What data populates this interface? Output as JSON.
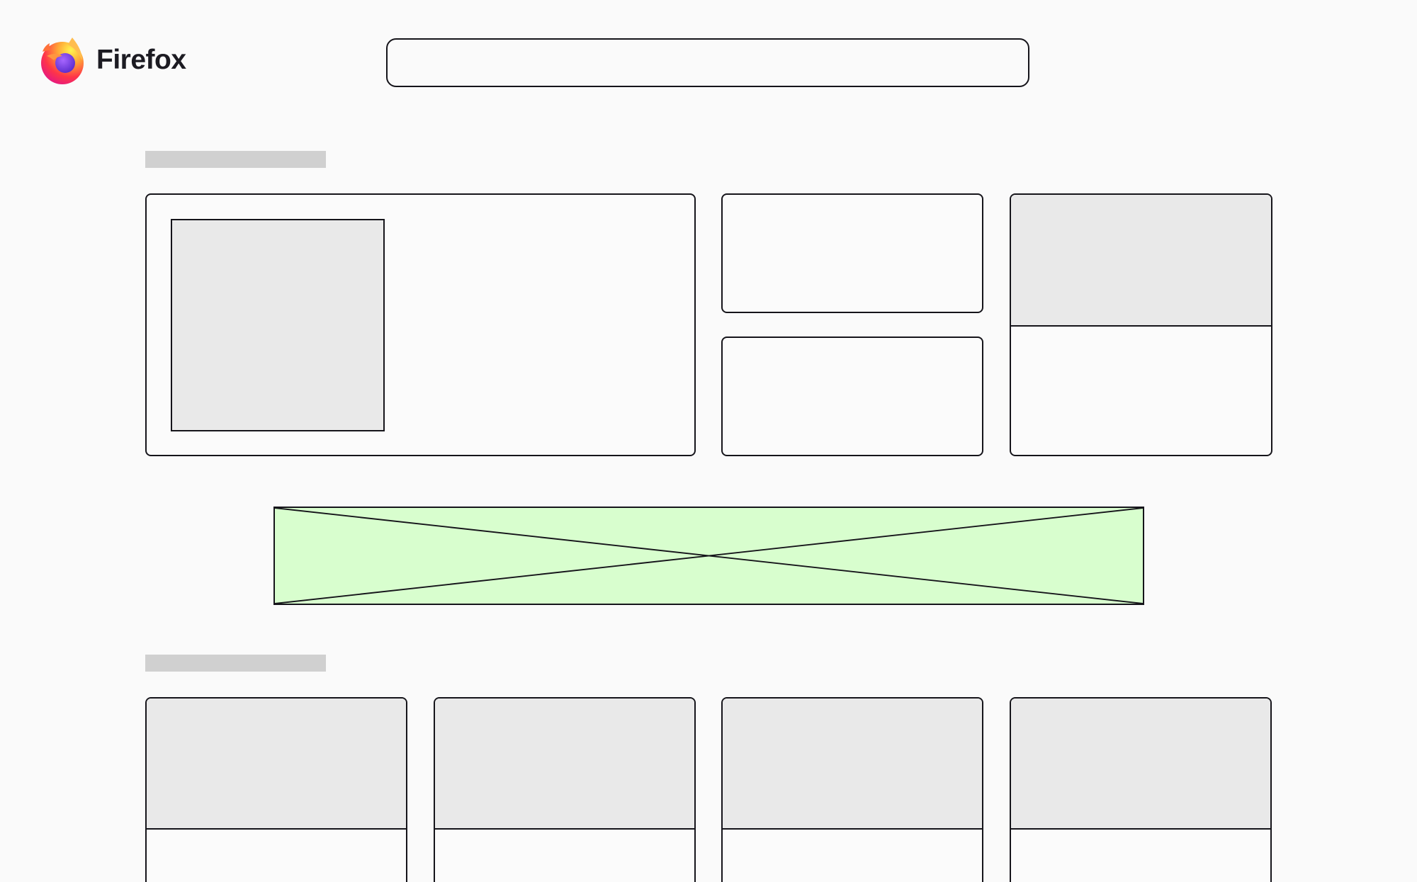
{
  "brand": {
    "name": "Firefox",
    "logo_icon": "firefox-logo-icon"
  },
  "search": {
    "value": "",
    "placeholder": ""
  },
  "sections": [
    {
      "heading": ""
    },
    {
      "heading": ""
    }
  ],
  "colors": {
    "background": "#fafafa",
    "outline": "#15141a",
    "placeholder_fill": "#e9e9e9",
    "heading_placeholder": "#d0d0d0",
    "ad_fill": "#d8fece"
  }
}
